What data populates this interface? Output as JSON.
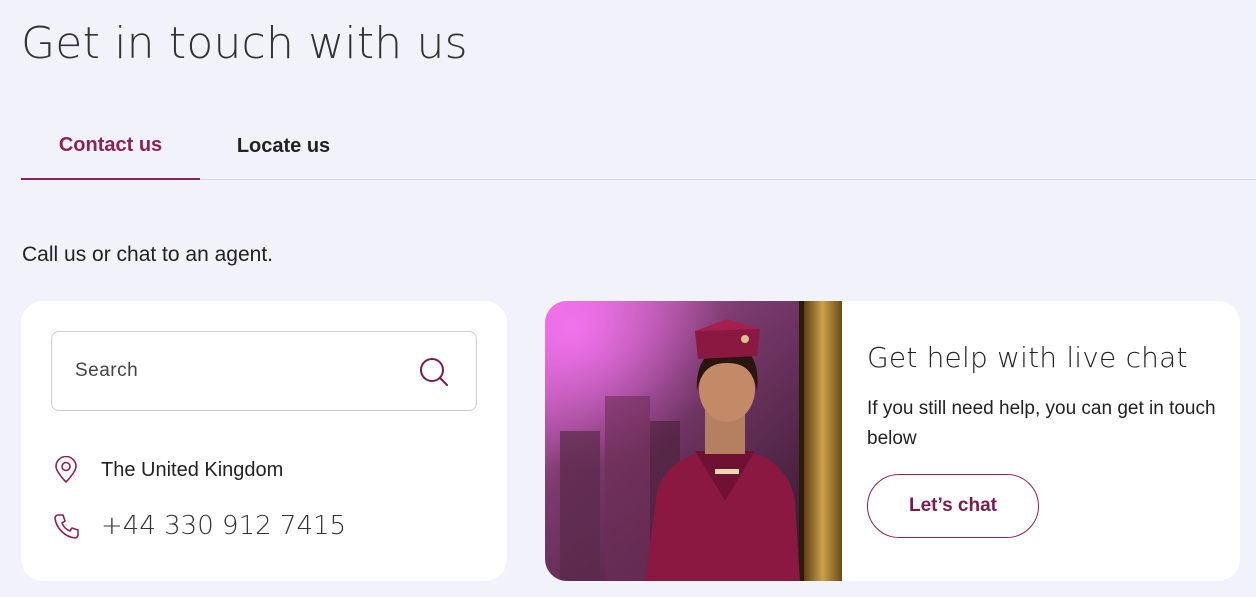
{
  "page": {
    "title": "Get in touch with us"
  },
  "tabs": [
    {
      "label": "Contact us",
      "active": true
    },
    {
      "label": "Locate us",
      "active": false
    }
  ],
  "intro": "Call us or chat to an agent.",
  "contact": {
    "search_placeholder": "Search",
    "location": "The United Kingdom",
    "phone": "+44 330 912 7415",
    "icons": {
      "search": "search-icon",
      "location": "map-pin-icon",
      "phone": "phone-icon"
    }
  },
  "live_chat": {
    "title": "Get help with live chat",
    "description": "If you still need help, you can get in touch below",
    "button_label": "Let’s chat",
    "image_alt": "Cabin crew member in burgundy uniform inside aircraft cabin"
  },
  "colors": {
    "accent": "#8e2157",
    "background": "#f2f2fa",
    "card": "#ffffff"
  }
}
